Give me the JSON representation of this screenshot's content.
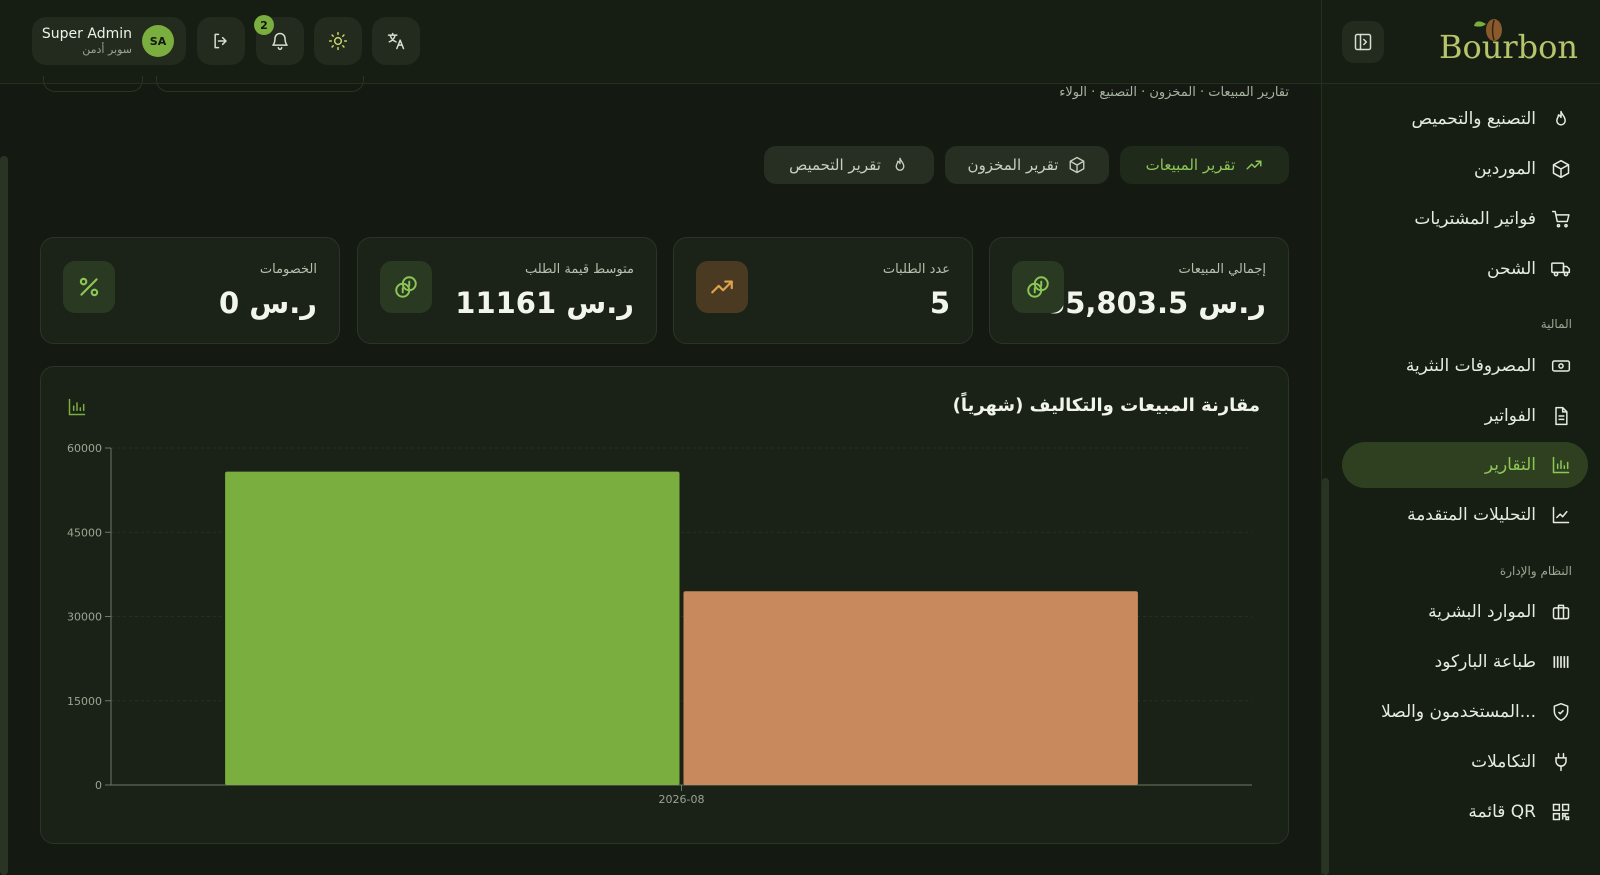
{
  "sidebar": {
    "logo": "Bourbon",
    "items_top": [
      {
        "label": "التصنيع والتحميص",
        "icon": "flame-icon"
      },
      {
        "label": "الموردين",
        "icon": "package-icon"
      },
      {
        "label": "فواتير المشتريات",
        "icon": "cart-icon"
      },
      {
        "label": "الشحن",
        "icon": "truck-icon"
      }
    ],
    "section_finance": "المالية",
    "items_finance": [
      {
        "label": "المصروفات النثرية",
        "icon": "cash-icon"
      },
      {
        "label": "الفواتير",
        "icon": "file-icon"
      },
      {
        "label": "التقارير",
        "icon": "bar-chart-icon",
        "active": true
      },
      {
        "label": "التحليلات المتقدمة",
        "icon": "line-chart-icon"
      }
    ],
    "section_system": "النظام والإدارة",
    "items_system": [
      {
        "label": "الموارد البشرية",
        "icon": "briefcase-icon"
      },
      {
        "label": "طباعة الباركود",
        "icon": "barcode-icon"
      },
      {
        "label": "المستخدمون والصلا...",
        "icon": "shield-icon"
      },
      {
        "label": "التكاملات",
        "icon": "plug-icon"
      },
      {
        "label": "قائمة QR",
        "icon": "qr-icon"
      }
    ]
  },
  "topbar": {
    "user_name": "Super Admin",
    "user_role": "سوبر أدمن",
    "avatar_initials": "SA",
    "notifications_count": "2"
  },
  "page": {
    "breadcrumb": "تقارير المبيعات · المخزون · التصنيع · الولاء",
    "tabs": [
      {
        "label": "تقرير المبيعات",
        "icon": "trending-up-icon",
        "active": true
      },
      {
        "label": "تقرير المخزون",
        "icon": "box-icon"
      },
      {
        "label": "تقرير التحميص",
        "icon": "flame-icon"
      }
    ]
  },
  "stats": [
    {
      "label": "إجمالي المبيعات",
      "value": "55,803.5 ر.س",
      "icon": "coins-icon"
    },
    {
      "label": "عدد الطلبات",
      "value": "5",
      "icon": "trending-up-icon"
    },
    {
      "label": "متوسط قيمة الطلب",
      "value": "11161 ر.س",
      "icon": "coins-icon"
    },
    {
      "label": "الخصومات",
      "value": "0 ر.س",
      "icon": "percent-icon"
    }
  ],
  "colors": {
    "accent": "#7aae3f",
    "sales_bar": "#7aae3f",
    "cost_bar": "#c88a5c"
  },
  "chart_data": {
    "type": "bar",
    "title": "مقارنة المبيعات والتكاليف (شهرياً)",
    "categories": [
      "2026-08"
    ],
    "series": [
      {
        "values": [
          55803.5
        ],
        "color": "#7aae3f"
      },
      {
        "values": [
          34500
        ],
        "color": "#c88a5c"
      }
    ],
    "ylim": [
      0,
      60000
    ],
    "yticks": [
      "0",
      "15000",
      "30000",
      "45000",
      "60000"
    ],
    "xlabel": "",
    "ylabel": "",
    "grid": true
  }
}
